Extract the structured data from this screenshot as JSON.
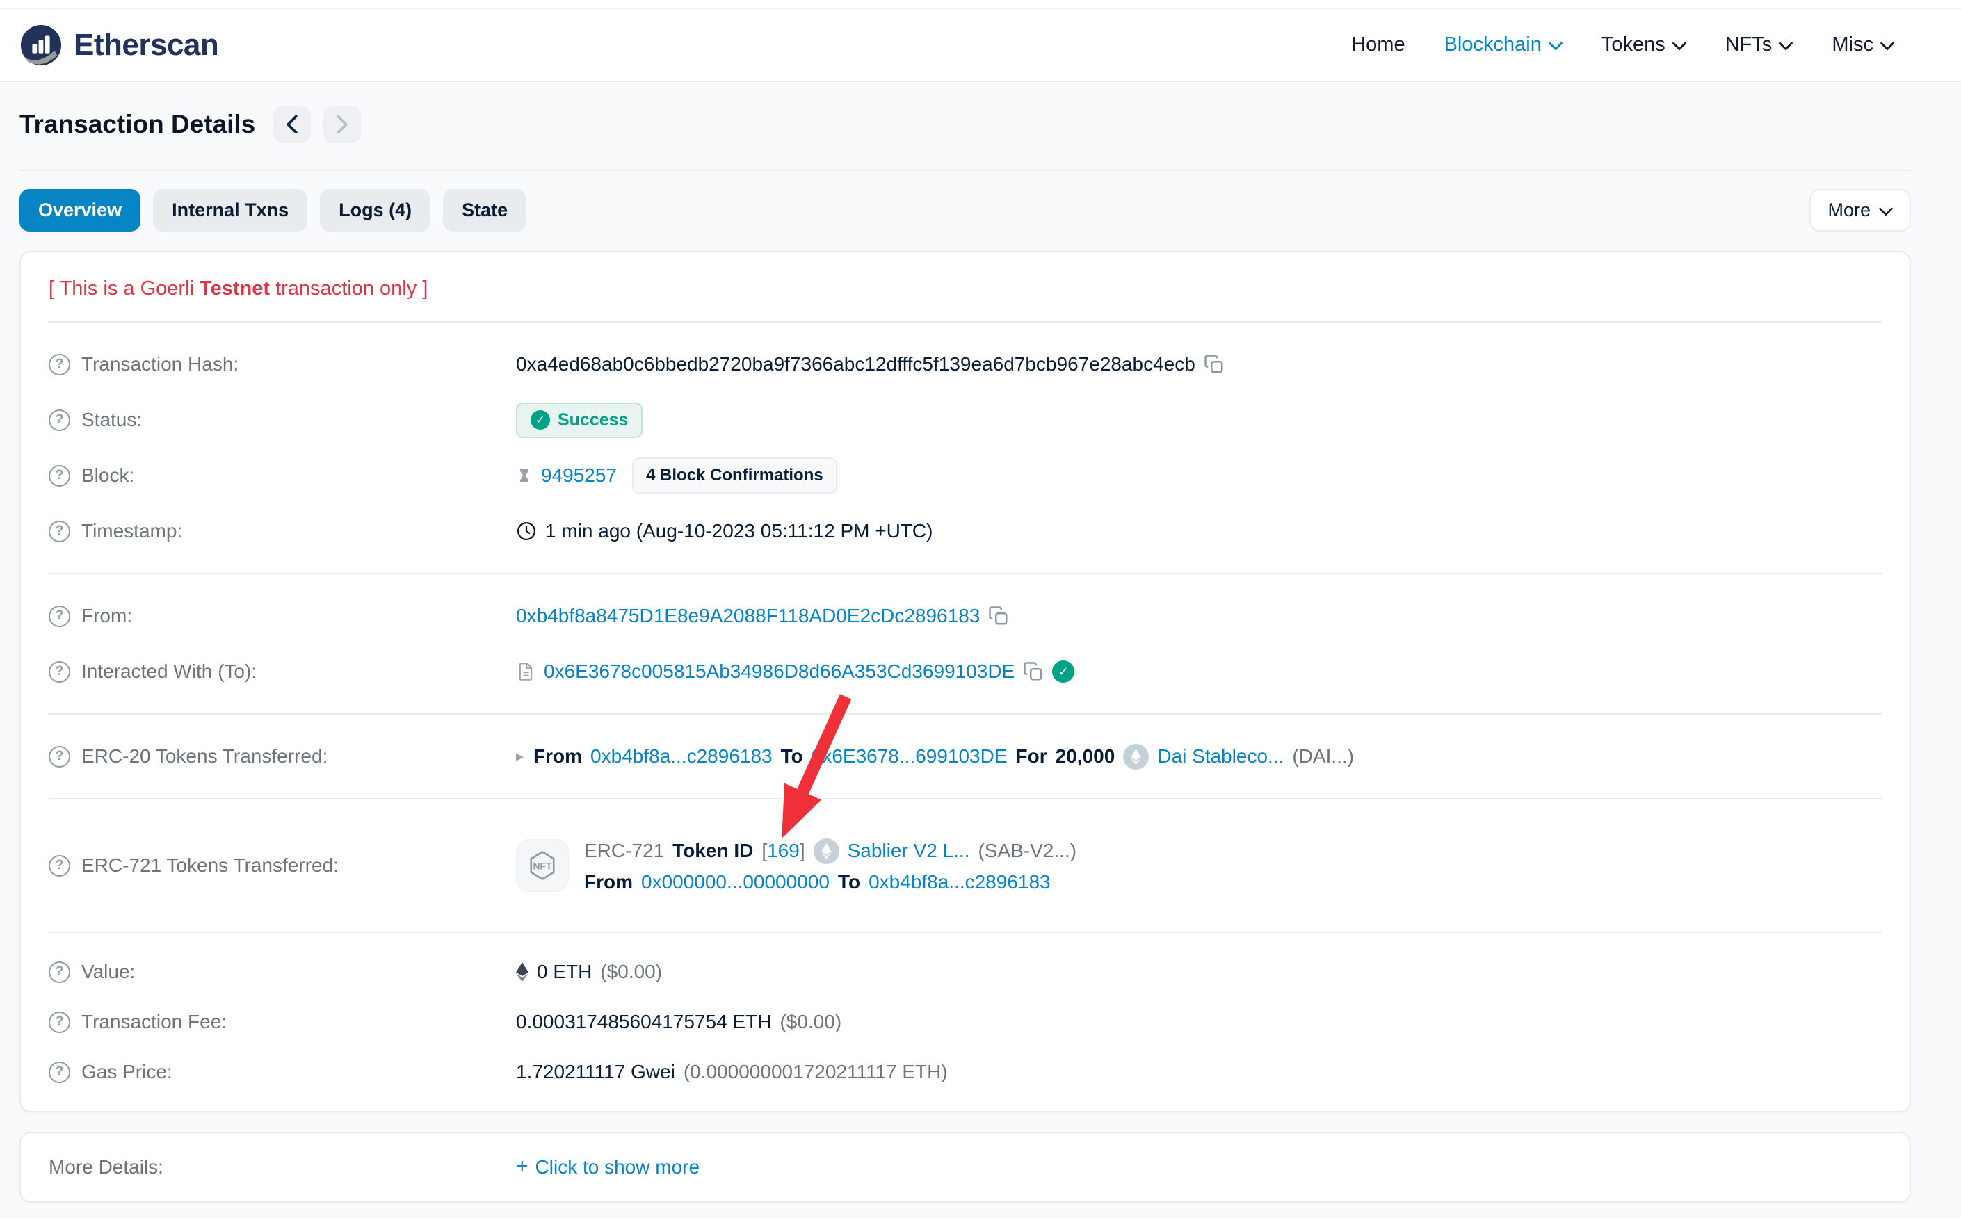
{
  "nav": {
    "brand": "Etherscan",
    "items": [
      {
        "label": "Home",
        "chevron": false,
        "active": false
      },
      {
        "label": "Blockchain",
        "chevron": true,
        "active": true
      },
      {
        "label": "Tokens",
        "chevron": true,
        "active": false
      },
      {
        "label": "NFTs",
        "chevron": true,
        "active": false
      },
      {
        "label": "Misc",
        "chevron": true,
        "active": false
      }
    ]
  },
  "page": {
    "title": "Transaction Details"
  },
  "tabs": [
    {
      "label": "Overview",
      "active": true
    },
    {
      "label": "Internal Txns",
      "active": false
    },
    {
      "label": "Logs (4)",
      "active": false
    },
    {
      "label": "State",
      "active": false
    }
  ],
  "more_button": "More",
  "overview": {
    "warning": {
      "prefix": "[ This is a Goerli ",
      "bold": "Testnet",
      "suffix": " transaction only ]"
    },
    "rows": {
      "transaction_hash": {
        "label": "Transaction Hash:",
        "value": "0xa4ed68ab0c6bbedb2720ba9f7366abc12dfffc5f139ea6d7bcb967e28abc4ecb"
      },
      "status": {
        "label": "Status:",
        "value": "Success"
      },
      "block": {
        "label": "Block:",
        "number": "9495257",
        "confirmations": "4 Block Confirmations"
      },
      "timestamp": {
        "label": "Timestamp:",
        "value": "1 min ago (Aug-10-2023 05:11:12 PM +UTC)"
      },
      "from": {
        "label": "From:",
        "address": "0xb4bf8a8475D1E8e9A2088F118AD0E2cDc2896183"
      },
      "interacted": {
        "label": "Interacted With (To):",
        "address": "0x6E3678c005815Ab34986D8d66A353Cd3699103DE"
      },
      "erc20": {
        "label": "ERC-20 Tokens Transferred:",
        "from_label": "From",
        "from": "0xb4bf8a...c2896183",
        "to_label": "To",
        "to": "0x6E3678...699103DE",
        "for_label": "For",
        "amount": "20,000",
        "token": "Dai Stableco...",
        "symbol": "(DAI...)"
      },
      "erc721": {
        "label": "ERC-721 Tokens Transferred:",
        "standard": "ERC-721",
        "token_id_label": "Token ID",
        "bracket_open": "[",
        "token_id": "169",
        "bracket_close": "]",
        "token": "Sablier V2 L...",
        "symbol": "(SAB-V2...)",
        "from_label": "From",
        "from": "0x000000...00000000",
        "to_label": "To",
        "to": "0xb4bf8a...c2896183",
        "nft_badge": "NFT"
      },
      "value": {
        "label": "Value:",
        "value": "0 ETH",
        "usd": "($0.00)"
      },
      "fee": {
        "label": "Transaction Fee:",
        "value": "0.000317485604175754 ETH",
        "usd": "($0.00)"
      },
      "gas_price": {
        "label": "Gas Price:",
        "value": "1.720211117 Gwei",
        "alt": "(0.000000001720211117 ETH)"
      }
    }
  },
  "more_details": {
    "label": "More Details:",
    "action": "Click to show more"
  },
  "icons": {
    "help": "?",
    "check": "✓",
    "caret": "▸",
    "plus": "+"
  },
  "colors": {
    "brand_blue": "#0784c3",
    "brand_navy": "#21325b",
    "success_green": "#00a186",
    "warning_red": "#dc3545",
    "arrow_red": "#ef3038"
  }
}
